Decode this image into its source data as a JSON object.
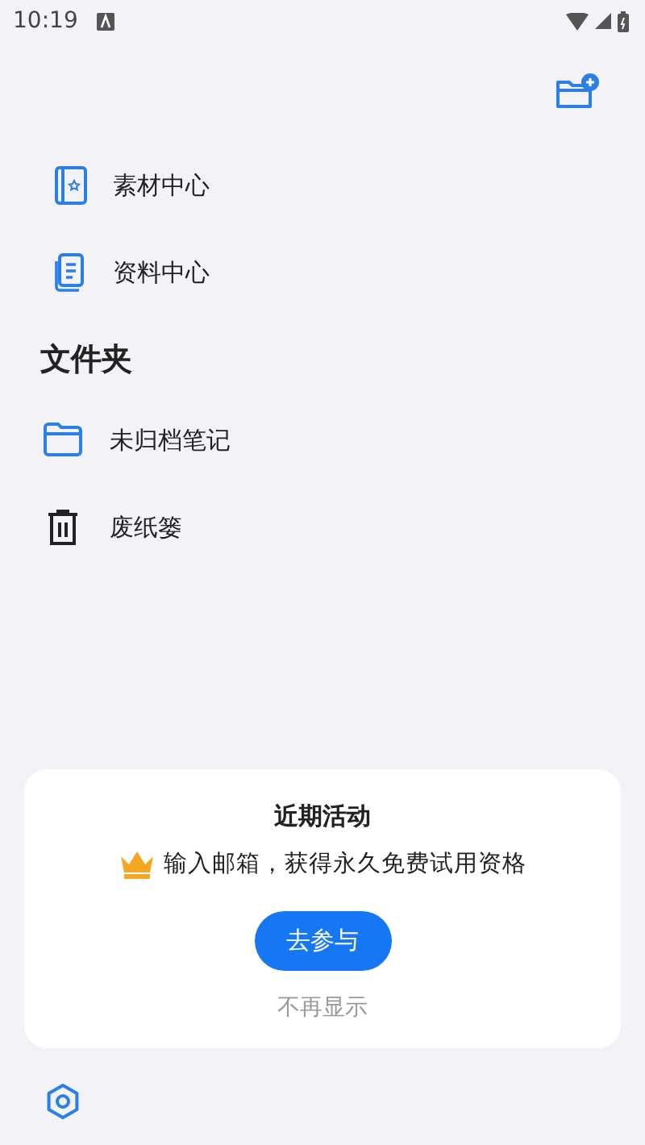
{
  "status_bar": {
    "time": "10:19"
  },
  "top_items": [
    {
      "label": "素材中心",
      "kind": "book"
    },
    {
      "label": "资料中心",
      "kind": "document"
    }
  ],
  "folders": {
    "title": "文件夹",
    "items": [
      {
        "label": "未归档笔记",
        "kind": "folder"
      },
      {
        "label": "废纸篓",
        "kind": "trash"
      }
    ]
  },
  "promo": {
    "title": "近期活动",
    "message": "输入邮箱，获得永久免费试用资格",
    "button": "去参与",
    "dismiss": "不再显示"
  }
}
